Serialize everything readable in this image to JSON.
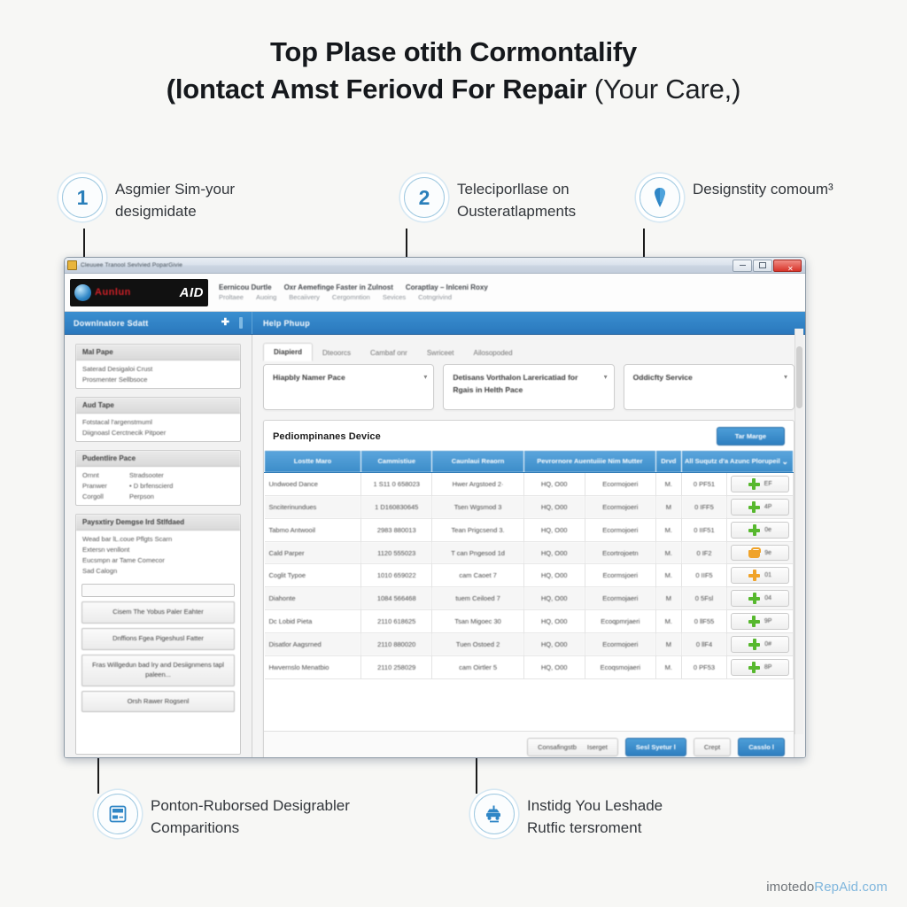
{
  "title": {
    "line1": "Top Plase otith Cormontalify",
    "line2_bold": "(lontact Amst Feriovd For Repair",
    "line2_soft": "(Your Care,)"
  },
  "callouts": [
    {
      "badge": "1",
      "icon": "number-badge",
      "line1": "Asgmier Sim-your",
      "line2": "desigmidate"
    },
    {
      "badge": "2",
      "icon": "number-badge",
      "line1": "Teleciporllase on",
      "line2": "Ousteratlapments"
    },
    {
      "badge": "",
      "icon": "pin-icon",
      "line1": "Designstity comoum³",
      "line2": ""
    },
    {
      "badge": "",
      "icon": "card-reader-icon",
      "line1": "Ponton-Ruborsed Desigrabler",
      "line2": "Comparitions"
    },
    {
      "badge": "",
      "icon": "car-lift-icon",
      "line1": "Instidg You Leshade",
      "line2": "Rutfic tersroment"
    }
  ],
  "window": {
    "titlebar": "Cleuuee Tranool Sevlvied PoparGivie",
    "buttons": {
      "minimize": "minimize-icon",
      "maximize": "maximize-icon",
      "close": "close-icon"
    },
    "brand": {
      "word1": "Aunlun",
      "word2": "AID"
    },
    "menu_top": [
      "Eernicou Durtle",
      "Oxr Aemefinge Faster in Zulnost",
      "Coraptlay – Inlceni Roxy"
    ],
    "menu_sub": [
      "Proltaee",
      "Auoing",
      "Becaiivery",
      "Cergomntion",
      "Sevices",
      "Cotngrivind"
    ],
    "strip_left": "Downlnatore Sdatt",
    "strip_left_plus": "✚",
    "strip_right": "Help Phuup"
  },
  "sidebar": {
    "panels": [
      {
        "head": "Mal Pape",
        "lines": [
          "Saterad Desigaloi Crust",
          "Prosmenter Sellbsoce"
        ]
      },
      {
        "head": "Aud Tape",
        "lines": [
          "Fotstacal l'argenstmuml",
          "Diignoasl Cerctnecik Pitpoer"
        ]
      },
      {
        "head": "Pudentlire Pace",
        "pairs": [
          {
            "k": "Ornnt",
            "v": "Stradsooter"
          },
          {
            "k": "Pranwer",
            "v": "• D brfenscierd"
          },
          {
            "k": "Corgoll",
            "v": "Perpson"
          }
        ]
      },
      {
        "head": "Paysxtiry Demgse Ird Stlfdaed",
        "lines": [
          "Wead bar lL.coue Pflgts Scarn",
          "Extersn venllont",
          "Eucsmpn ar Tame Comecor",
          "Sad Calogn"
        ],
        "field_placeholder": "",
        "buttons": [
          "Cisem The Yobus Paler Eahter",
          "Dnffions Fgea Pigeshusl Fatter",
          "Fras Willgedun bad lry and Desiignmens tapl paleen...",
          "Orsh Rawer Rogsenl"
        ]
      }
    ]
  },
  "main": {
    "tabs": [
      {
        "label": "Diapierd",
        "active": true
      },
      {
        "label": "Dteoorcs",
        "active": false
      },
      {
        "label": "Cambaf onr",
        "active": false
      },
      {
        "label": "Swriceet",
        "active": false
      },
      {
        "label": "Ailosopoded",
        "active": false
      }
    ],
    "filters": [
      {
        "value": "Hiapbly Namer Pace",
        "caret": "chevron-down-icon"
      },
      {
        "value": "Detisans Vorthalon Larericatiad for Rgais in Helth Pace",
        "caret": "chevron-down-icon"
      },
      {
        "value": "Oddicfty Service",
        "caret": "chevron-down-icon"
      }
    ],
    "card_title": "Pediompinanes Device",
    "card_action": "Tar Marge",
    "table": {
      "columns": [
        "Lostte Maro",
        "Cammistiue",
        "Caunlaui Reaorn",
        "Pevrornore Auentuiiie Nim Mutter",
        "Drvd",
        "All Suqutz d'a Azunc Plorupeil"
      ],
      "header_caret": "chevron-down-icon",
      "rows": [
        {
          "cells": [
            "Undwoed Dance",
            "1 S11 0 658023",
            "Hwer Argstoed 2·",
            "HQ, O00",
            "Ecormojoeri",
            "M.",
            "0 PF51"
          ],
          "action": {
            "icon": "plus-icon",
            "color": "#57b82e",
            "label": "EF"
          }
        },
        {
          "cells": [
            "Snciterinundues",
            "1 D160830645",
            "Tsen Wgsmod 3",
            "HQ, O00",
            "Ecormojoeri",
            "M",
            "0 IFF5"
          ],
          "action": {
            "icon": "plus-icon",
            "color": "#57b82e",
            "label": "4P"
          }
        },
        {
          "cells": [
            "Tabmo Antwooil",
            "2983 880013",
            "Tean Prigcsend 3.",
            "HQ, O00",
            "Ecormojoeri",
            "M.",
            "0 IIF51"
          ],
          "action": {
            "icon": "plus-icon",
            "color": "#57b82e",
            "label": "0e"
          }
        },
        {
          "cells": [
            "Cald Parper",
            "1120 555023",
            "T can Pngesod 1d",
            "HQ, O00",
            "Ecortrojoetn",
            "M.",
            "0 IF2"
          ],
          "action": {
            "icon": "cart-icon",
            "color": "#f0a32a",
            "label": "9e"
          }
        },
        {
          "cells": [
            "Coglit Typoe",
            "1010 659022",
            "cam Caoet 7",
            "HQ, O00",
            "Ecormsjoeri",
            "M.",
            "0 IIF5"
          ],
          "action": {
            "icon": "plus-icon",
            "color": "#f0a32a",
            "label": "01"
          }
        },
        {
          "cells": [
            "Diahonte",
            "1084 566468",
            "tuem Ceiloed 7",
            "HQ, O00",
            "Ecormojaeri",
            "M",
            "0 5Fsl"
          ],
          "action": {
            "icon": "plus-icon",
            "color": "#57b82e",
            "label": "04"
          }
        },
        {
          "cells": [
            "Dc Lobid Pieta",
            "2110 618625",
            "Tsan Migoec 30",
            "HQ, O00",
            "Ecoqpmrjaeri",
            "M.",
            "0 llF55"
          ],
          "action": {
            "icon": "plus-icon",
            "color": "#57b82e",
            "label": "9P"
          }
        },
        {
          "cells": [
            "Disatlor Aagsrned",
            "2110 880020",
            "Tuen Ostoed 2",
            "HQ, O00",
            "Ecormojoeri",
            "M",
            "0 llF4"
          ],
          "action": {
            "icon": "plus-icon",
            "color": "#57b82e",
            "label": "0#"
          }
        },
        {
          "cells": [
            "Hwvernslo Menatbio",
            "2110 258029",
            "cam Oirtler 5",
            "HQ, O00",
            "Ecoqsmojaeri",
            "M.",
            "0 PF53"
          ],
          "action": {
            "icon": "plus-icon",
            "color": "#57b82e",
            "label": "8P"
          }
        }
      ]
    },
    "footer_buttons": [
      {
        "label": "Consafingstb",
        "label2": "Iserget",
        "primary": false
      },
      {
        "label": "Sesl Syetur l",
        "label2": "",
        "primary": true
      },
      {
        "label": "Crept",
        "label2": "",
        "primary": false
      },
      {
        "label": "Casslo l",
        "label2": "",
        "primary": true
      }
    ]
  },
  "watermark": {
    "a": "imotedo",
    "b": "RepAid.com"
  }
}
